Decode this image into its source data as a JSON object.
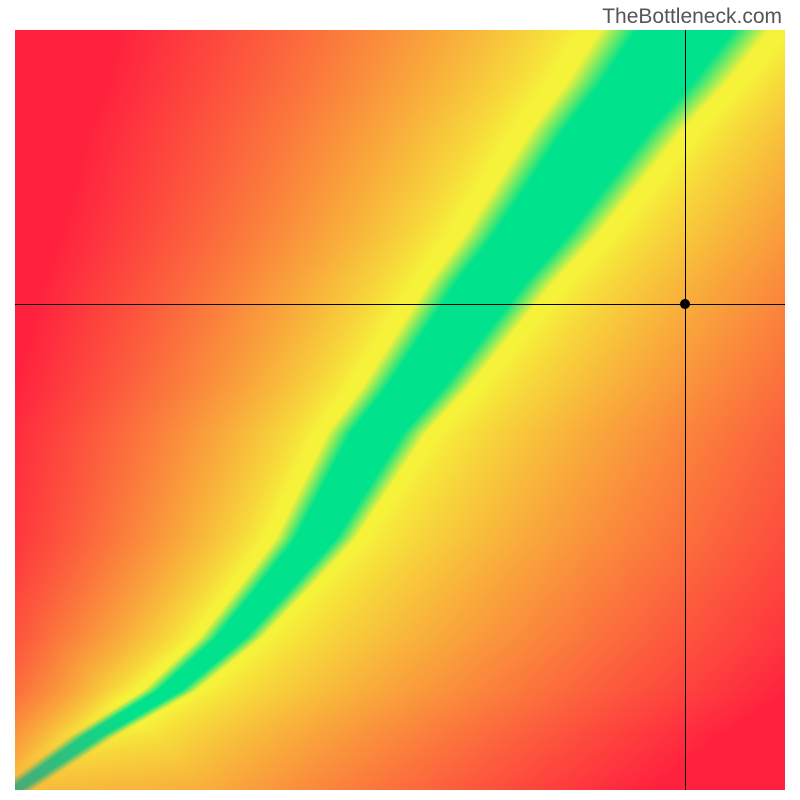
{
  "watermark": "TheBottleneck.com",
  "chart_data": {
    "type": "heatmap",
    "title": "",
    "xlabel": "",
    "ylabel": "",
    "x_range": [
      0,
      1
    ],
    "y_range": [
      0,
      1
    ],
    "marker": {
      "x": 0.87,
      "y": 0.64
    },
    "green_ridge_xy": [
      [
        0.0,
        0.0
      ],
      [
        0.1,
        0.07
      ],
      [
        0.2,
        0.13
      ],
      [
        0.28,
        0.2
      ],
      [
        0.34,
        0.27
      ],
      [
        0.39,
        0.33
      ],
      [
        0.43,
        0.4
      ],
      [
        0.47,
        0.47
      ],
      [
        0.52,
        0.53
      ],
      [
        0.57,
        0.6
      ],
      [
        0.62,
        0.67
      ],
      [
        0.67,
        0.73
      ],
      [
        0.72,
        0.8
      ],
      [
        0.77,
        0.87
      ],
      [
        0.82,
        0.93
      ],
      [
        0.87,
        1.0
      ]
    ],
    "color_stops": {
      "optimal": "#00E38C",
      "near": "#F6F23A",
      "bad": "#FF213E"
    },
    "description": "Heatmap showing bottleneck compatibility. Green band = ideal pairing, yellow = moderate mismatch, red = severe bottleneck. Black crosshair marks a specific configuration at (0.87, 0.64)."
  }
}
